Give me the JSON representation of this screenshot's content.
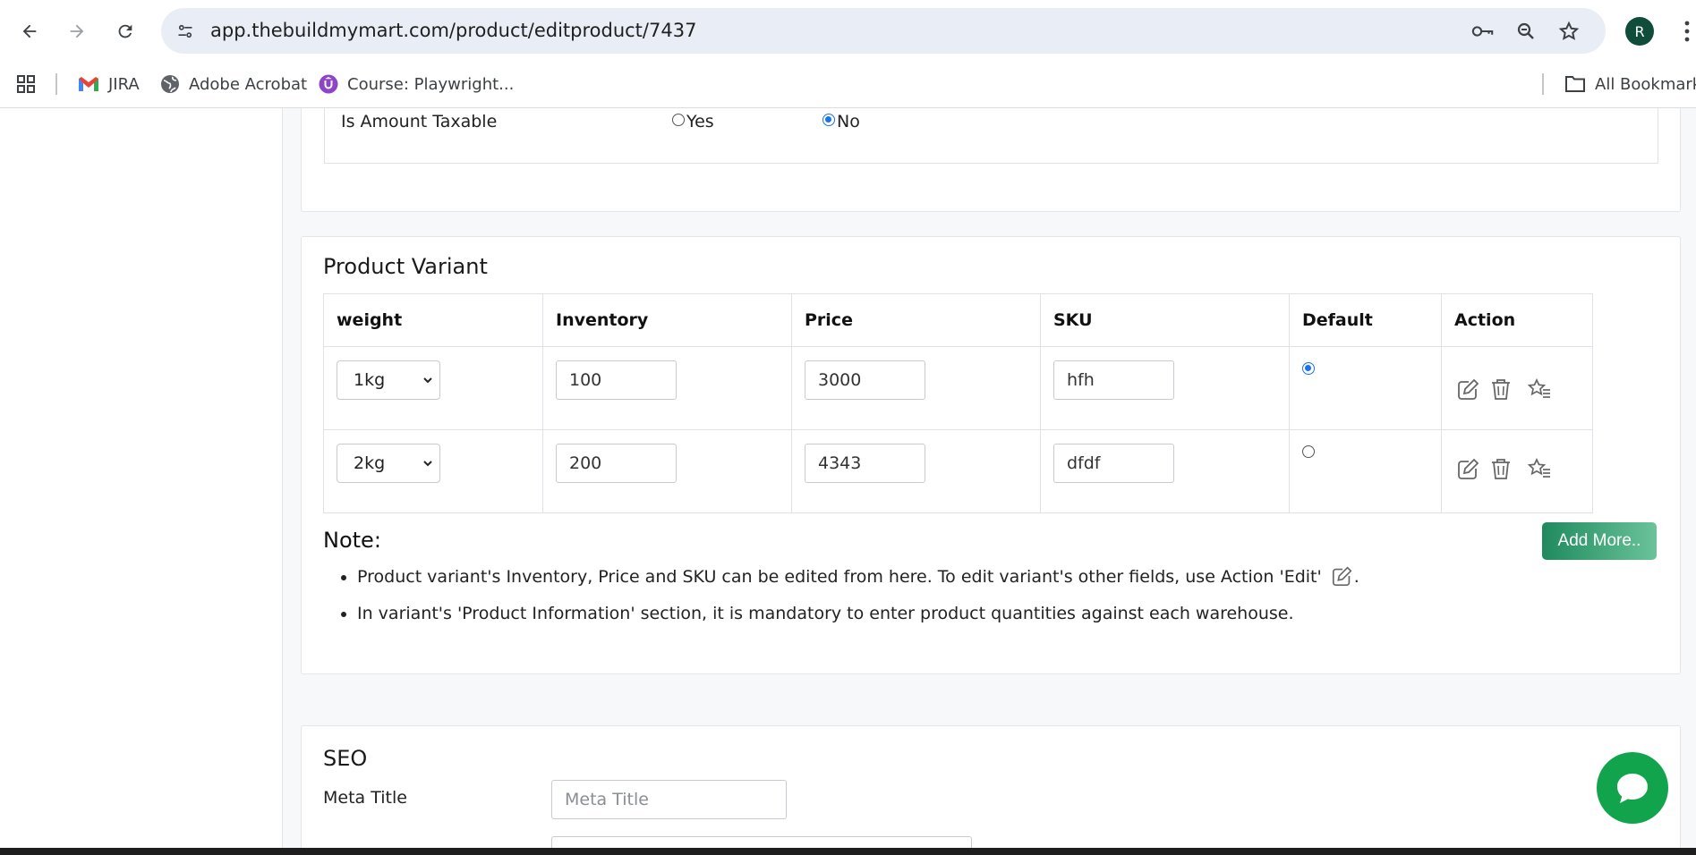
{
  "browser": {
    "url": "app.thebuildmymart.com/product/editproduct/7437",
    "profile_initial": "R",
    "bookmarks": [
      {
        "label": "JIRA",
        "icon": "gmail-icon"
      },
      {
        "label": "Adobe Acrobat",
        "icon": "globe-icon"
      },
      {
        "label": "Course: Playwright...",
        "icon": "udemy-icon"
      }
    ],
    "all_bookmarks_label": "All Bookmarks"
  },
  "taxable": {
    "label": "Is Amount Taxable",
    "options": [
      "Yes",
      "No"
    ],
    "selected": "No"
  },
  "variant_section": {
    "title": "Product Variant",
    "columns": [
      "weight",
      "Inventory",
      "Price",
      "SKU",
      "Default",
      "Action"
    ],
    "rows": [
      {
        "weight": "1kg",
        "inventory": "100",
        "price": "3000",
        "sku": "hfh",
        "default": true
      },
      {
        "weight": "2kg",
        "inventory": "200",
        "price": "4343",
        "sku": "dfdf",
        "default": false
      }
    ],
    "action_icons": [
      "edit-icon",
      "trash-icon",
      "star-list-icon"
    ]
  },
  "note": {
    "title": "Note:",
    "items": [
      "Product variant's Inventory, Price and SKU can be edited from here. To edit variant's other fields, use Action 'Edit'",
      "In variant's 'Product Information' section, it is mandatory to enter product quantities against each warehouse."
    ],
    "item1_suffix": "."
  },
  "add_more_label": "Add More..",
  "seo": {
    "title": "SEO",
    "meta_title_label": "Meta Title",
    "meta_title_placeholder": "Meta Title"
  },
  "colors": {
    "accent_green": "#11a44d",
    "button_gradient_start": "#1f8a5e",
    "radio_blue": "#1a73e8"
  }
}
